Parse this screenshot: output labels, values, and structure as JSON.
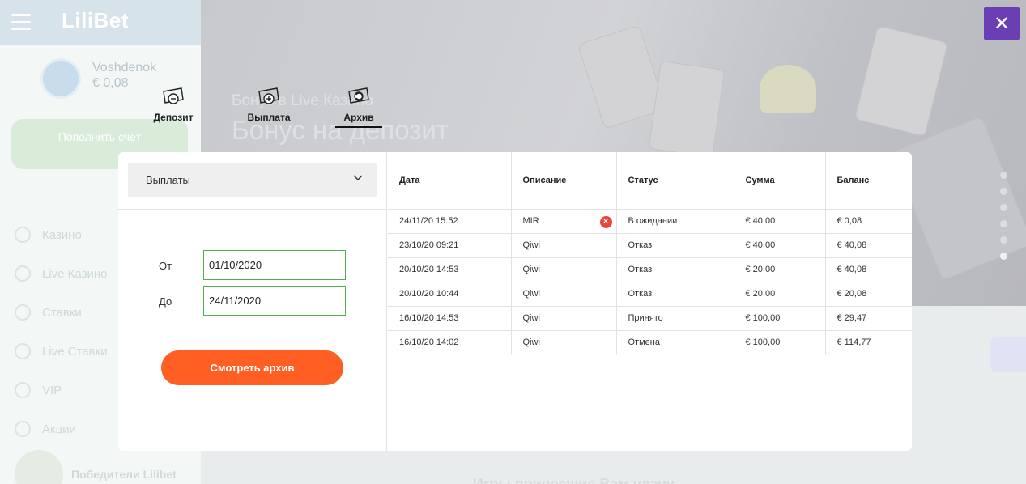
{
  "background": {
    "logo": "LiliBet",
    "user": {
      "name": "Voshdenok",
      "balance": "€ 0,08"
    },
    "deposit_button": "Пополнить счёт",
    "nav": [
      "Казино",
      "Live Казино",
      "Ставки",
      "Live Ставки",
      "VIP",
      "Акции"
    ],
    "winners": "Победители Lilibet",
    "hero": {
      "subtitle": "Бонус в Live Казино",
      "title": "Бонус на депозит"
    },
    "bottom_text": "Игры принесшие Вам удачу"
  },
  "tabs": [
    {
      "label": "Депозит",
      "icon": "cash-minus-icon"
    },
    {
      "label": "Выплата",
      "icon": "cash-plus-icon"
    },
    {
      "label": "Архив",
      "icon": "cash-history-icon",
      "active": true
    }
  ],
  "filter": {
    "type_selected": "Выплаты",
    "from_label": "От",
    "from_value": "01/10/2020",
    "to_label": "До",
    "to_value": "24/11/2020",
    "submit_label": "Смотреть архив"
  },
  "table": {
    "headers": [
      "Дата",
      "Описание",
      "Статус",
      "Сумма",
      "Баланс"
    ],
    "rows": [
      {
        "date": "24/11/20 15:52",
        "description": "MIR",
        "status": "В ожидании",
        "amount": "€ 40,00",
        "balance": "€ 0,08",
        "cancellable": true
      },
      {
        "date": "23/10/20 09:21",
        "description": "Qiwi",
        "status": "Отказ",
        "amount": "€ 40,00",
        "balance": "€ 40,08"
      },
      {
        "date": "20/10/20 14:53",
        "description": "Qiwi",
        "status": "Отказ",
        "amount": "€ 20,00",
        "balance": "€ 40,08"
      },
      {
        "date": "20/10/20 10:44",
        "description": "Qiwi",
        "status": "Отказ",
        "amount": "€ 20,00",
        "balance": "€ 20,08"
      },
      {
        "date": "16/10/20 14:53",
        "description": "Qiwi",
        "status": "Принято",
        "amount": "€ 100,00",
        "balance": "€ 29,47"
      },
      {
        "date": "16/10/20 14:02",
        "description": "Qiwi",
        "status": "Отмена",
        "amount": "€ 100,00",
        "balance": "€ 114,77"
      }
    ]
  },
  "colors": {
    "accent": "#ff5f23",
    "close_button": "#6a3fb3",
    "input_border": "#4caf50",
    "cancel_icon": "#e8453c"
  }
}
